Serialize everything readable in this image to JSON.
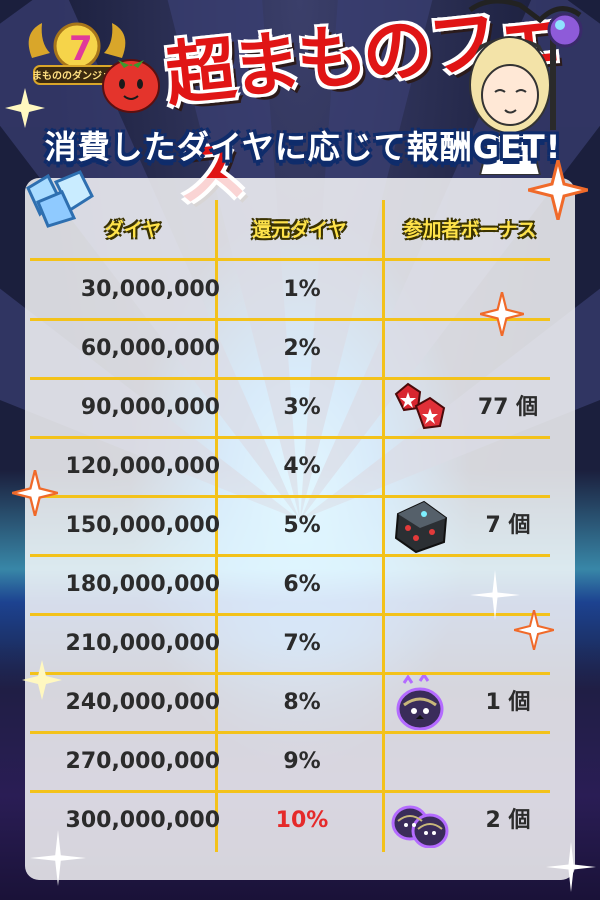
{
  "title": "超まものフェス",
  "logo_text": "まもののダンジョン",
  "logo_number": "7",
  "subtitle": "消費したダイヤに応じて報酬GET!",
  "headers": {
    "diamond": "ダイヤ",
    "rebate": "還元ダイヤ",
    "bonus": "参加者ボーナス"
  },
  "colors": {
    "accent": "#f3c21a",
    "highlight": "#e52a2a",
    "title": "#e01515"
  },
  "rows": [
    {
      "diamonds": "30,000,000",
      "rebate": "1%",
      "bonus_icon": "",
      "bonus_qty": ""
    },
    {
      "diamonds": "60,000,000",
      "rebate": "2%",
      "bonus_icon": "",
      "bonus_qty": ""
    },
    {
      "diamonds": "90,000,000",
      "rebate": "3%",
      "bonus_icon": "red-gem-icon",
      "bonus_qty": "77 個"
    },
    {
      "diamonds": "120,000,000",
      "rebate": "4%",
      "bonus_icon": "",
      "bonus_qty": ""
    },
    {
      "diamonds": "150,000,000",
      "rebate": "5%",
      "bonus_icon": "dark-dice-icon",
      "bonus_qty": "7 個"
    },
    {
      "diamonds": "180,000,000",
      "rebate": "6%",
      "bonus_icon": "",
      "bonus_qty": ""
    },
    {
      "diamonds": "210,000,000",
      "rebate": "7%",
      "bonus_icon": "",
      "bonus_qty": ""
    },
    {
      "diamonds": "240,000,000",
      "rebate": "8%",
      "bonus_icon": "purple-egg-icon",
      "bonus_qty": "1 個"
    },
    {
      "diamonds": "270,000,000",
      "rebate": "9%",
      "bonus_icon": "",
      "bonus_qty": ""
    },
    {
      "diamonds": "300,000,000",
      "rebate": "10%",
      "bonus_icon": "purple-eggs-icon",
      "bonus_qty": "2 個"
    }
  ]
}
